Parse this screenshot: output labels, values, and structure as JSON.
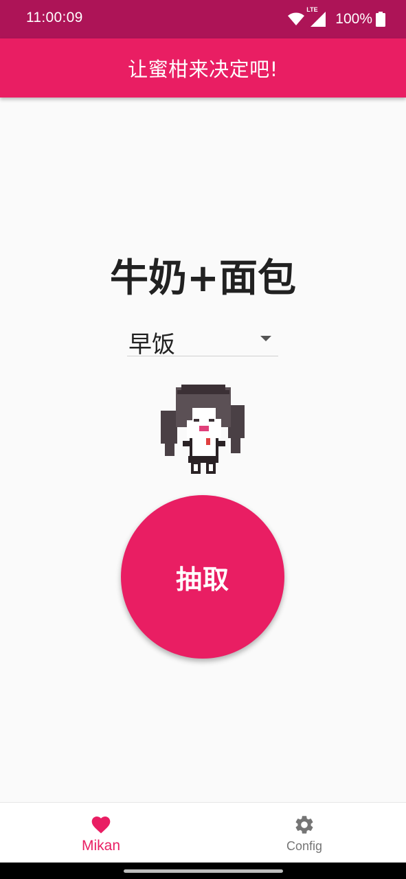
{
  "status_bar": {
    "time": "11:00:09",
    "battery_percent": "100%",
    "network": "LTE"
  },
  "app_bar": {
    "title": "让蜜柑来决定吧!"
  },
  "main": {
    "result_text": "牛奶+面包",
    "meal_select": {
      "selected": "早饭"
    },
    "draw_button_label": "抽取"
  },
  "bottom_nav": {
    "items": [
      {
        "label": "Mikan",
        "icon": "heart-icon",
        "active": true
      },
      {
        "label": "Config",
        "icon": "gear-icon",
        "active": false
      }
    ]
  },
  "colors": {
    "primary": "#e91e63",
    "primary_dark": "#ad1457",
    "background": "#fafafa",
    "inactive": "#757575"
  }
}
